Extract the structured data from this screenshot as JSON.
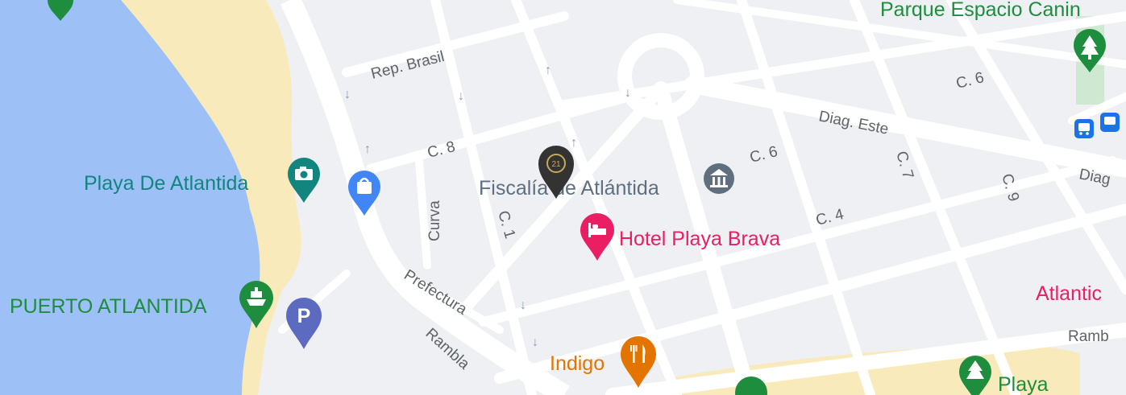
{
  "colors": {
    "water": "#9dc0f6",
    "beach": "#f8eabb",
    "land": "#eef0f3",
    "road": "#ffffff",
    "park_green": "#1e8e3e",
    "attraction_teal": "#12857f",
    "hotel_pink": "#e91e63",
    "food_orange": "#e37400",
    "gov_grey": "#5f6f80",
    "shop_blue": "#4285f4",
    "parking_indigo": "#5c6bc0",
    "transit_blue": "#1a73e8",
    "listing_marker": "#333333"
  },
  "places": {
    "parque": "Parque Espacio Canin",
    "playa_atlantida": "Playa De Atlantida",
    "fiscalia": "Fiscalía de Atlántida",
    "hotel": "Hotel Playa Brava",
    "puerto": "PUERTO ATLANTIDA",
    "indigo": "Indigo",
    "atlantic": "Atlantic",
    "playa": "Playa"
  },
  "streets": {
    "rep_brasil": "Rep. Brasil",
    "c6_top": "C. 6",
    "diag_este": "Diag. Este",
    "diag_right": "Diag",
    "c8": "C. 8",
    "c6": "C. 6",
    "c7": "C. 7",
    "c9": "C. 9",
    "curva": "Curva",
    "c1": "C. 1",
    "c4": "C. 4",
    "prefectura": "Prefectura",
    "rambla": "Rambla",
    "rambla_right": "Ramb"
  },
  "markers": {
    "listing_badge": "21"
  },
  "icons": {
    "park": "tree-icon",
    "attraction": "camera-icon",
    "shopping": "shopping-bag-icon",
    "government": "museum-icon",
    "hotel": "bed-icon",
    "ferry": "ferry-icon",
    "parking": "parking-icon",
    "food": "fork-knife-icon",
    "transit": "bus-icon",
    "listing": "century21-icon"
  },
  "parking_letter": "P"
}
